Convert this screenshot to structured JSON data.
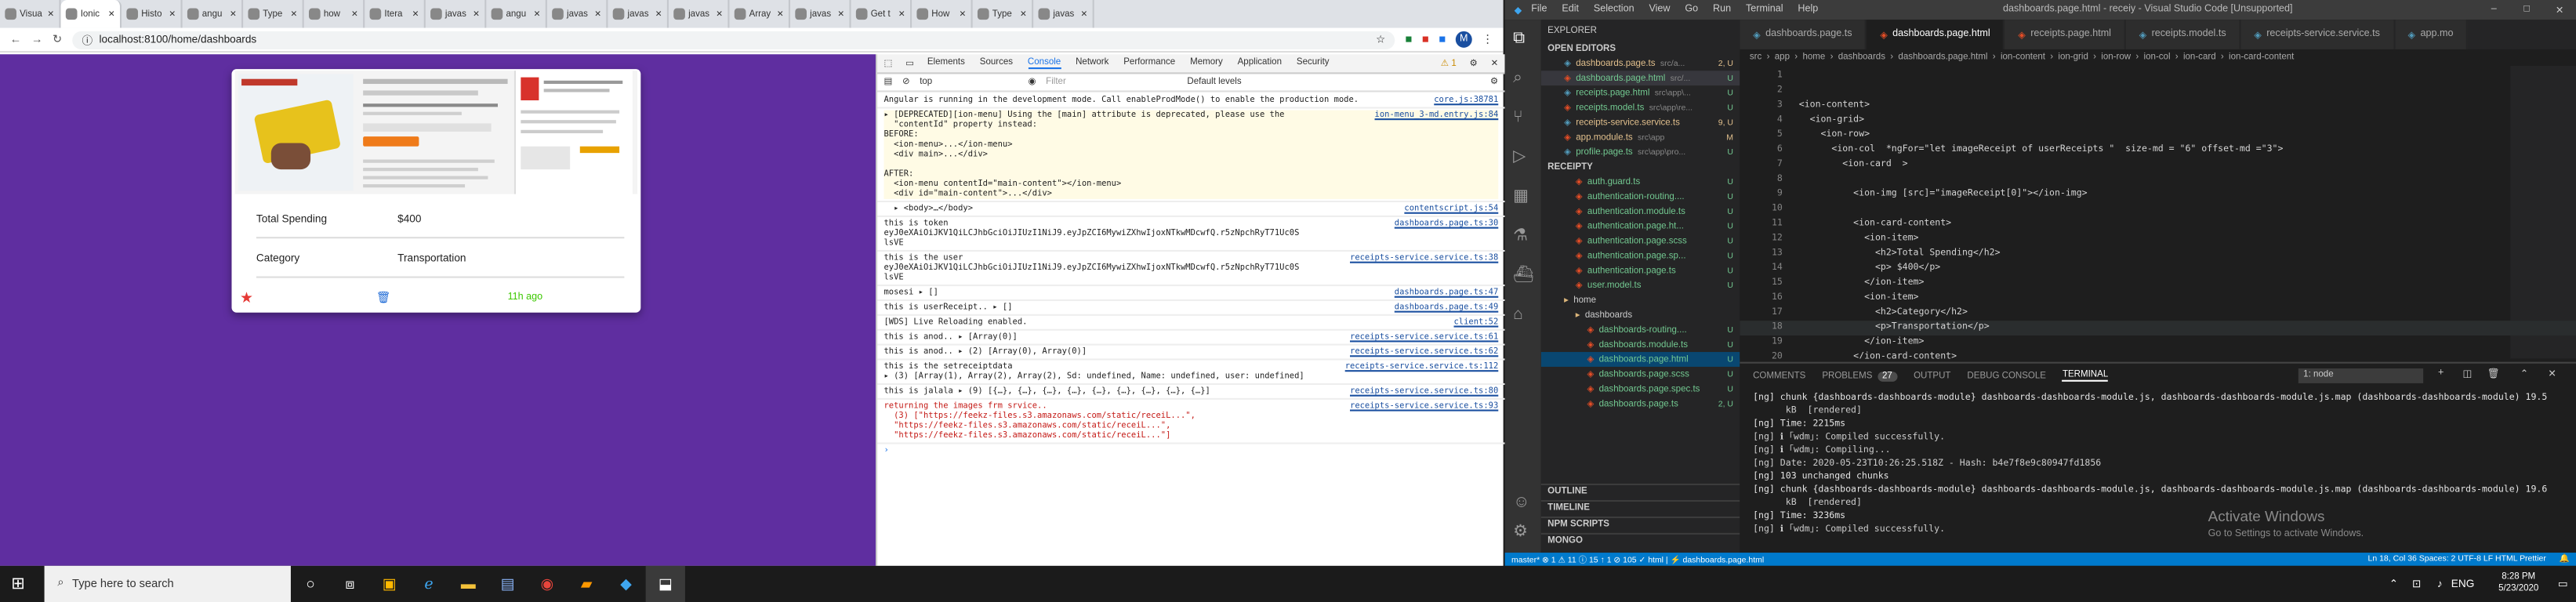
{
  "chrome": {
    "tabs": [
      "Visua",
      "Ionic",
      "Histo",
      "angu",
      "Type",
      "how",
      "Itera",
      "javas",
      "angu",
      "javas",
      "javas",
      "javas",
      "Array",
      "javas",
      "Get t",
      "How",
      "Type",
      "javas"
    ],
    "url": "localhost:8100/home/dashboards",
    "avatar": "M"
  },
  "card": {
    "rows": [
      {
        "label": "Total Spending",
        "value": "$400"
      },
      {
        "label": "Category",
        "value": "Transportation"
      }
    ],
    "time": "11h ago"
  },
  "devtools": {
    "tabs": [
      "Elements",
      "Sources",
      "Console",
      "Network",
      "Performance",
      "Memory",
      "Application",
      "Security"
    ],
    "warn_count": "1",
    "context": "top",
    "filter_placeholder": "Filter",
    "levels": "Default levels",
    "lines": [
      {
        "t": "Angular is running in the development mode. Call enableProdMode() to enable the production mode.",
        "s": "core.js:38781"
      },
      {
        "t": "▸ [DEPRECATED][ion-menu] Using the [main] attribute is deprecated, please use the\n  \"contentId\" property instead:\nBEFORE:\n  <ion-menu>...</ion-menu>\n  <div main>...</div>\n\nAFTER:\n  <ion-menu contentId=\"main-content\"></ion-menu>\n  <div id=\"main-content\">...</div>",
        "s": "ion-menu_3-md.entry.js:84"
      },
      {
        "t": "  ▸ <body>…</body>",
        "s": "contentscript.js:54"
      },
      {
        "t": "this is token\neyJ0eXAiOiJKV1QiLCJhbGciOiJIUzI1NiJ9.eyJpZCI6MywiZXhwIjoxNTkwMDcwfQ.r5zNpchRyT71Uc0S\nlsVE",
        "s": "dashboards.page.ts:30"
      },
      {
        "t": "this is the user\neyJ0eXAiOiJKV1QiLCJhbGciOiJIUzI1NiJ9.eyJpZCI6MywiZXhwIjoxNTkwMDcwfQ.r5zNpchRyT71Uc0S\nlsVE",
        "s": "receipts-service.service.ts:38"
      },
      {
        "t": "mosesi ▸ []",
        "s": "dashboards.page.ts:47"
      },
      {
        "t": "this is userReceipt.. ▸ []",
        "s": "dashboards.page.ts:49"
      },
      {
        "t": "[WDS] Live Reloading enabled.",
        "s": "client:52"
      },
      {
        "t": "this is anod.. ▸ [Array(0)]",
        "s": "receipts-service.service.ts:61"
      },
      {
        "t": "this is anod.. ▸ (2) [Array(0), Array(0)]",
        "s": "receipts-service.service.ts:62"
      },
      {
        "t": "this is the setreceiptdata\n▸ (3) [Array(1), Array(2), Array(2), Sd: undefined, Name: undefined, user: undefined]",
        "s": "receipts-service.service.ts:112"
      },
      {
        "t": "this is jalala ▸ (9) [{…}, {…}, {…}, {…}, {…}, {…}, {…}, {…}, {…}]",
        "s": "receipts-service.service.ts:80"
      },
      {
        "t": "returning the images frm srvice..\n  (3) [\"https://feekz-files.s3.amazonaws.com/static/receiL...\",\n  \"https://feekz-files.s3.amazonaws.com/static/receiL...\",\n  \"https://feekz-files.s3.amazonaws.com/static/receiL...\"]",
        "s": "receipts-service.service.ts:93"
      }
    ]
  },
  "vscode": {
    "menu": [
      "File",
      "Edit",
      "Selection",
      "View",
      "Go",
      "Run",
      "Terminal",
      "Help"
    ],
    "title": "dashboards.page.html - receiy - Visual Studio Code [Unsupported]",
    "explorer": "EXPLORER",
    "open_editors_label": "OPEN EDITORS",
    "open_editors": [
      {
        "name": "dashboards.page.ts",
        "path": "src/a...",
        "st": "2, U",
        "c": "#e2c08d"
      },
      {
        "name": "dashboards.page.html",
        "path": "src/...",
        "st": "U",
        "c": "#73c991"
      },
      {
        "name": "receipts.page.html",
        "path": "src\\app\\...",
        "st": "U",
        "c": "#73c991"
      },
      {
        "name": "receipts.model.ts",
        "path": "src\\app\\re...",
        "st": "U",
        "c": "#73c991"
      },
      {
        "name": "receipts-service.service.ts",
        "path": "",
        "st": "9, U",
        "c": "#e2c08d"
      },
      {
        "name": "app.module.ts",
        "path": "src\\app",
        "st": "M",
        "c": "#e2c08d"
      },
      {
        "name": "profile.page.ts",
        "path": "src\\app\\pro...",
        "st": "U",
        "c": "#73c991"
      }
    ],
    "project_label": "RECEIPTY",
    "files": [
      {
        "name": "auth.guard.ts",
        "st": "U",
        "indent": 1
      },
      {
        "name": "authentication-routing....",
        "st": "U",
        "indent": 1
      },
      {
        "name": "authentication.module.ts",
        "st": "U",
        "indent": 1
      },
      {
        "name": "authentication.page.ht...",
        "st": "U",
        "indent": 1
      },
      {
        "name": "authentication.page.scss",
        "st": "U",
        "indent": 1
      },
      {
        "name": "authentication.page.sp...",
        "st": "U",
        "indent": 1
      },
      {
        "name": "authentication.page.ts",
        "st": "U",
        "indent": 1
      },
      {
        "name": "user.model.ts",
        "st": "U",
        "indent": 1
      },
      {
        "name": "home",
        "st": "",
        "indent": 0
      },
      {
        "name": "dashboards",
        "st": "",
        "indent": 1
      },
      {
        "name": "dashboards-routing....",
        "st": "U",
        "indent": 2
      },
      {
        "name": "dashboards.module.ts",
        "st": "U",
        "indent": 2
      },
      {
        "name": "dashboards.page.html",
        "st": "U",
        "indent": 2
      },
      {
        "name": "dashboards.page.scss",
        "st": "U",
        "indent": 2
      },
      {
        "name": "dashboards.page.spec.ts",
        "st": "U",
        "indent": 2
      },
      {
        "name": "dashboards.page.ts",
        "st": "2, U",
        "indent": 2
      }
    ],
    "sections": [
      "OUTLINE",
      "TIMELINE",
      "NPM SCRIPTS",
      "MONGO"
    ],
    "editor_tabs": [
      "dashboards.page.ts",
      "dashboards.page.html",
      "receipts.page.html",
      "receipts.model.ts",
      "receipts-service.service.ts",
      "app.mo"
    ],
    "breadcrumb": [
      "src",
      "app",
      "home",
      "dashboards",
      "dashboards.page.html",
      "ion-content",
      "ion-grid",
      "ion-row",
      "ion-col",
      "ion-card",
      "ion-card-content"
    ],
    "code": [
      "",
      "",
      "<ion-content>",
      "  <ion-grid>",
      "    <ion-row>",
      "      <ion-col  *ngFor=\"let imageReceipt of userReceipts \"  size-md = \"6\" offset-md =\"3\">",
      "        <ion-card  >",
      "",
      "          <ion-img [src]=\"imageReceipt[0]\"></ion-img>",
      "",
      "          <ion-card-content>",
      "            <ion-item>",
      "              <h2>Total Spending</h2>",
      "              <p> $400</p>",
      "            </ion-item>",
      "            <ion-item>",
      "              <h2>Category</h2>",
      "              <p>Transportation</p>",
      "            </ion-item>",
      "          </ion-card-content>"
    ],
    "panel_tabs": [
      "COMMENTS",
      "PROBLEMS",
      "OUTPUT",
      "DEBUG CONSOLE",
      "TERMINAL"
    ],
    "problems_count": "27",
    "terminal_select": "1: node",
    "terminal": [
      "[ng] chunk {dashboards-dashboards-module} dashboards-dashboards-module.js, dashboards-dashboards-module.js.map (dashboards-dashboards-module) 19.5",
      "      kB  [rendered]",
      "[ng] Time: 2215ms",
      "[ng] ℹ ｢wdm｣: Compiled successfully.",
      "[ng] ℹ ｢wdm｣: Compiling...",
      "[ng] Date: 2020-05-23T10:26:25.518Z - Hash: b4e7f8e9c80947fd1856",
      "[ng] 103 unchanged chunks",
      "[ng] chunk {dashboards-dashboards-module} dashboards-dashboards-module.js, dashboards-dashboards-module.js.map (dashboards-dashboards-module) 19.6",
      "      kB  [rendered]",
      "[ng] Time: 3236ms",
      "[ng] ℹ ｢wdm｣: Compiled successfully."
    ],
    "activate_title": "Activate Windows",
    "activate_sub": "Go to Settings to activate Windows.",
    "status_left": "master*   ⊗ 1  ⚠ 11  ⓘ 15   ↑ 1   ⊘ 105   ✓ html | ⚡ dashboards.page.html",
    "status_right": "Ln 18, Col 36   Spaces: 2   UTF-8   LF   HTML   Prettier"
  },
  "taskbar": {
    "search_placeholder": "Type here to search",
    "lang": "ENG",
    "time": "8:28 PM",
    "date": "5/23/2020"
  }
}
